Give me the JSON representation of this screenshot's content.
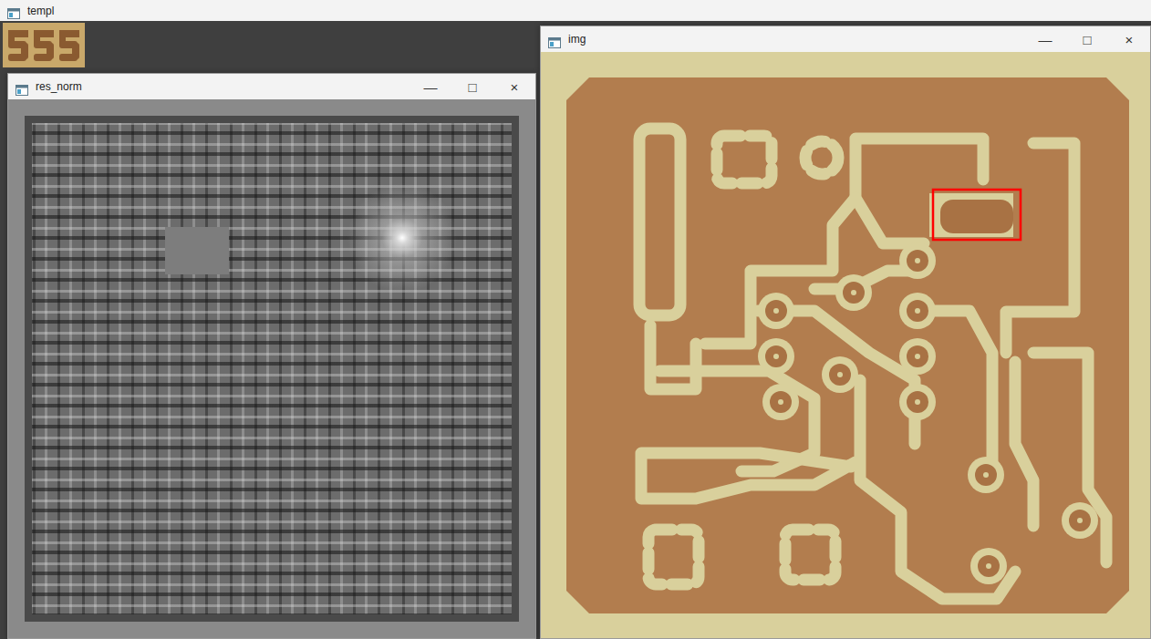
{
  "windows": [
    {
      "title": "templ",
      "kind": "template",
      "controls": []
    },
    {
      "title": "res_norm",
      "kind": "heatmap",
      "controls": [
        "—",
        "□",
        "×"
      ]
    },
    {
      "title": "img",
      "kind": "pcb",
      "controls": [
        "—",
        "□",
        "×"
      ]
    }
  ]
}
